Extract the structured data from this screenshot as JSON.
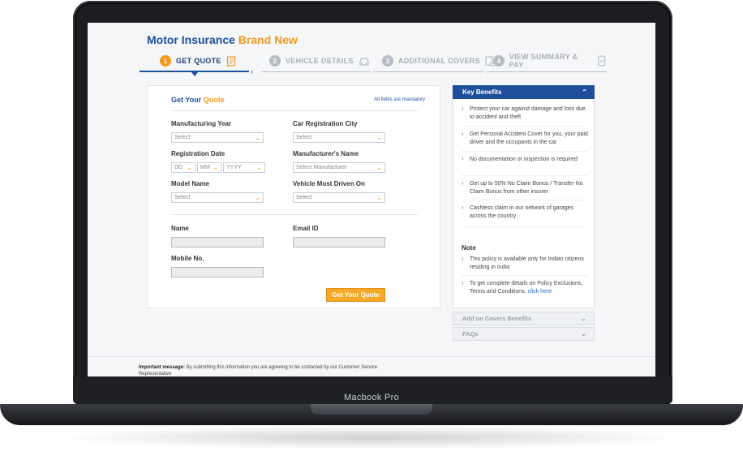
{
  "device": {
    "label": "Macbook Pro"
  },
  "page": {
    "title_main": "Motor Insurance",
    "title_accent": "Brand New"
  },
  "steps": [
    {
      "num": "1",
      "label": "GET QUOTE"
    },
    {
      "num": "2",
      "label": "VEHICLE DETAILS"
    },
    {
      "num": "3",
      "label": "ADDITIONAL COVERS"
    },
    {
      "num": "4",
      "label": "VIEW SUMMARY & PAY"
    }
  ],
  "form": {
    "heading_main": "Get Your",
    "heading_accent": "Quote",
    "mandatory_note": "All fields are mandatory",
    "manufacturing_year": {
      "label": "Manufacturing Year",
      "value": "Select"
    },
    "registration_city": {
      "label": "Car Registration City",
      "value": "Select"
    },
    "registration_date": {
      "label": "Registration Date",
      "day": "DD",
      "month": "MM",
      "year": "YYYY"
    },
    "manufacturer": {
      "label": "Manufacturer's Name",
      "value": "Select Manufacturer"
    },
    "model": {
      "label": "Model Name",
      "value": "Select"
    },
    "vehicle_driven_on": {
      "label": "Vehicle Most Driven On",
      "value": "Select"
    },
    "name": {
      "label": "Name",
      "value": ""
    },
    "email": {
      "label": "Email ID",
      "value": ""
    },
    "mobile": {
      "label": "Mobile No.",
      "value": ""
    },
    "submit_label": "Get Your Quote"
  },
  "sidebar": {
    "key_benefits_title": "Key Benefits",
    "benefits": [
      "Protect your car against damage and loss due to accident and theft",
      "Get Personal Accident Cover for you, your paid driver and the occupants in the car",
      "No documentation or inspection is required",
      "Get up to 50% No Claim Bonus / Transfer No Claim Bonus from other insurer",
      "Cashless claim in our network of garages across the country"
    ],
    "note_title": "Note",
    "notes": [
      "This policy is available only for Indian citizens residing in India",
      "To get complete details on Policy Exclusions, Terms and Conditions,"
    ],
    "note_link": "click here",
    "add_on_title": "Add on Covers Benefits",
    "faqs_title": "FAQs"
  },
  "footer": {
    "label": "Important message:",
    "text": "By submitting this information you are agreeing to be contacted by our Customer Service Representative"
  },
  "colors": {
    "brand_blue": "#1f4f9b",
    "accent_orange": "#f39a1e"
  }
}
